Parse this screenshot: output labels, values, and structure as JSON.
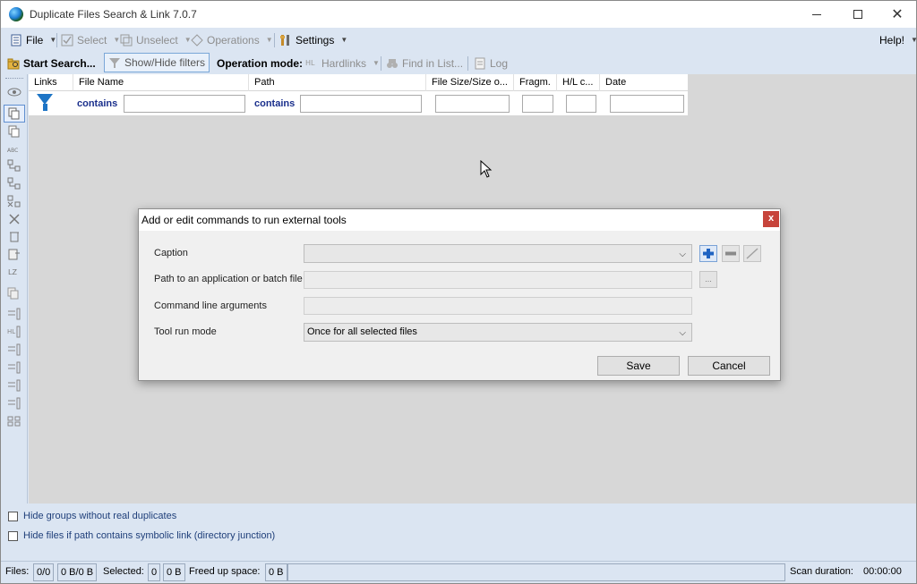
{
  "window": {
    "title": "Duplicate Files Search & Link 7.0.7",
    "help": "Help!"
  },
  "menu": {
    "file": "File",
    "select": "Select",
    "unselect": "Unselect",
    "operations": "Operations",
    "settings": "Settings"
  },
  "toolbar": {
    "start_search": "Start Search...",
    "show_hide_filters": "Show/Hide filters",
    "operation_mode_label": "Operation mode:",
    "hardlinks": "Hardlinks",
    "find_in_list": "Find in List...",
    "log": "Log"
  },
  "grid": {
    "columns": [
      "Links",
      "File Name",
      "Path",
      "File Size/Size o...",
      "Fragm.",
      "H/L c...",
      "Date"
    ],
    "filter_contains_1": "contains",
    "filter_contains_2": "contains"
  },
  "options": {
    "hide_groups": "Hide groups without real duplicates",
    "hide_symlinks": "Hide files if path contains symbolic link (directory junction)"
  },
  "status": {
    "files_label": "Files:",
    "files_count": "0/0",
    "files_size": "0 B/0 B",
    "selected_label": "Selected:",
    "selected_count": "0",
    "selected_size": "0 B",
    "freed_label": "Freed up space:",
    "freed_value": "0 B",
    "scan_label": "Scan duration:",
    "scan_value": "00:00:00"
  },
  "dialog": {
    "title": "Add or edit commands to run external tools",
    "close": "x",
    "caption_label": "Caption",
    "caption_value": "",
    "path_label": "Path to an application or batch file",
    "path_value": "",
    "browse": "...",
    "args_label": "Command line arguments",
    "args_value": "",
    "run_mode_label": "Tool run mode",
    "run_mode_value": "Once for all selected files",
    "save": "Save",
    "cancel": "Cancel"
  }
}
